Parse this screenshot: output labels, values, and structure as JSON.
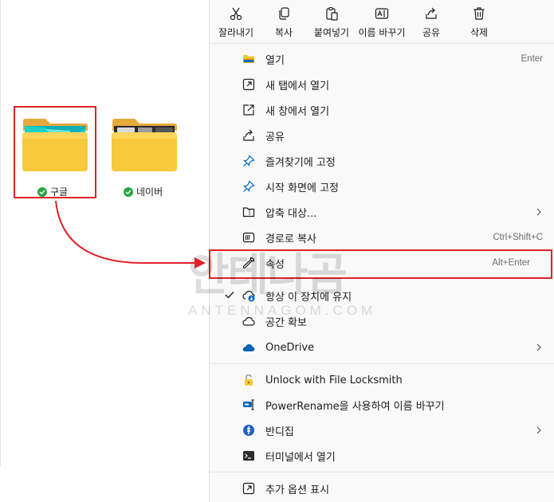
{
  "toolbar": [
    {
      "label": "잘라내기",
      "icon": "cut-icon"
    },
    {
      "label": "복사",
      "icon": "copy-icon"
    },
    {
      "label": "붙여넣기",
      "icon": "paste-icon"
    },
    {
      "label": "이름 바꾸기",
      "icon": "rename-icon"
    },
    {
      "label": "공유",
      "icon": "share-icon"
    },
    {
      "label": "삭제",
      "icon": "delete-icon"
    }
  ],
  "folders": [
    {
      "label": "구글"
    },
    {
      "label": "네이버"
    }
  ],
  "menu": {
    "open": {
      "label": "열기",
      "shortcut": "Enter"
    },
    "open_new_tab": {
      "label": "새 탭에서 열기"
    },
    "open_new_window": {
      "label": "새 창에서 열기"
    },
    "share": {
      "label": "공유"
    },
    "pin_favorites": {
      "label": "즐겨찾기에 고정"
    },
    "pin_start": {
      "label": "시작 화면에 고정"
    },
    "compress": {
      "label": "압축 대상..."
    },
    "copy_path": {
      "label": "경로로 복사",
      "shortcut": "Ctrl+Shift+C"
    },
    "properties": {
      "label": "속성",
      "shortcut": "Alt+Enter"
    },
    "keep_on_device": {
      "label": "항상 이 장치에 유지"
    },
    "free_space": {
      "label": "공간 확보"
    },
    "onedrive": {
      "label": "OneDrive"
    },
    "locksmith": {
      "label": "Unlock with File Locksmith"
    },
    "powerrename": {
      "label": "PowerRename을 사용하여 이름 바꾸기"
    },
    "bandizip": {
      "label": "반디집"
    },
    "terminal": {
      "label": "터미널에서 열기"
    },
    "more_options": {
      "label": "추가 옵션 표시"
    }
  },
  "watermark": {
    "big": "안테나곰",
    "small": "ANTENNAGOM.COM"
  },
  "colors": {
    "accent": "#0067c0",
    "highlight": "#e0202a",
    "folder": "#f8c93c",
    "check": "#2aa644"
  }
}
